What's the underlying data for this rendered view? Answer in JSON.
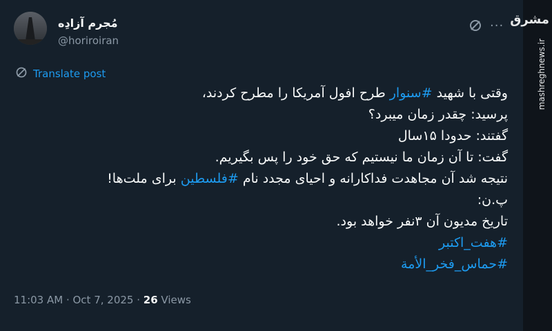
{
  "author": {
    "display_name": "مُجرم آزادِه",
    "handle": "@horiroiran"
  },
  "header": {
    "grok_icon": "slashed-circle-icon",
    "more_label": "···"
  },
  "translate": {
    "label": "Translate post",
    "icon": "translate-icon"
  },
  "tweet": {
    "line1_pre": "وقتی با شهید ",
    "line1_tag": "#سنوار",
    "line1_post": " طرح افول آمریکا را مطرح کردند،",
    "line2": "پرسید: چقدر زمان میبرد؟",
    "line3": "گفتند: حدودا ۱۵سال",
    "line4": "گفت: تا آن زمان ما نیستیم که حق خود را پس بگیریم.",
    "line5_pre": "نتیجه شد آن مجاهدت فداکارانه و احیای مجدد نام ",
    "line5_tag": "#فلسطین",
    "line5_post": " برای ملت‌ها!",
    "line6": "پ.ن:",
    "line7": "تاریخ مدیون آن ۳نفر خواهد بود.",
    "hashtag1": "#هفت_اکتبر",
    "hashtag2": "#حماس_فخر_الأمة"
  },
  "meta": {
    "time": "11:03 AM · Oct 7, 2025 · ",
    "views_count": "26",
    "views_label": " Views"
  },
  "watermark": {
    "logo": "مشرق",
    "site": "mashreghnews.ir"
  },
  "colors": {
    "background": "#15202b",
    "accent": "#1d9bf0",
    "muted": "#8b98a5",
    "text": "#f7f9f9"
  }
}
